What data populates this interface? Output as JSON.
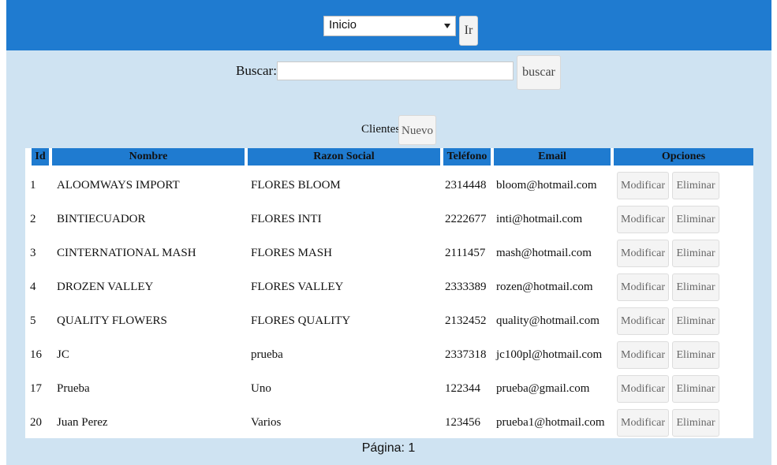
{
  "nav": {
    "selected": "Inicio",
    "go_label": "Ir"
  },
  "search": {
    "label": "Buscar:",
    "value": "",
    "placeholder": "",
    "button_label": "buscar"
  },
  "section": {
    "title": "Clientes",
    "new_label": "Nuevo"
  },
  "table": {
    "columns": [
      "Id",
      "Nombre",
      "Razon Social",
      "Teléfono",
      "Email",
      "Opciones"
    ],
    "rows": [
      {
        "id": "1",
        "nombre": "ALOOMWAYS IMPORT",
        "razon": "FLORES BLOOM",
        "telefono": "2314448",
        "email": "bloom@hotmail.com"
      },
      {
        "id": "2",
        "nombre": "BINTIECUADOR",
        "razon": "FLORES INTI",
        "telefono": "2222677",
        "email": "inti@hotmail.com"
      },
      {
        "id": "3",
        "nombre": "CINTERNATIONAL MASH",
        "razon": "FLORES MASH",
        "telefono": "2111457",
        "email": "mash@hotmail.com"
      },
      {
        "id": "4",
        "nombre": "DROZEN VALLEY",
        "razon": "FLORES VALLEY",
        "telefono": "2333389",
        "email": "rozen@hotmail.com"
      },
      {
        "id": "5",
        "nombre": "QUALITY FLOWERS",
        "razon": "FLORES QUALITY",
        "telefono": "2132452",
        "email": "quality@hotmail.com"
      },
      {
        "id": "16",
        "nombre": "JC",
        "razon": "prueba",
        "telefono": "2337318",
        "email": "jc100pl@hotmail.com"
      },
      {
        "id": "17",
        "nombre": "Prueba",
        "razon": "Uno",
        "telefono": "122344",
        "email": "prueba@gmail.com"
      },
      {
        "id": "20",
        "nombre": "Juan Perez",
        "razon": "Varios",
        "telefono": "123456",
        "email": "prueba1@hotmail.com"
      }
    ],
    "modify_label": "Modificar",
    "delete_label": "Eliminar"
  },
  "pagination": {
    "text": "Página: 1"
  },
  "colors": {
    "header_blue": "#1f7bd0",
    "panel_bg": "#cfe3f2"
  }
}
